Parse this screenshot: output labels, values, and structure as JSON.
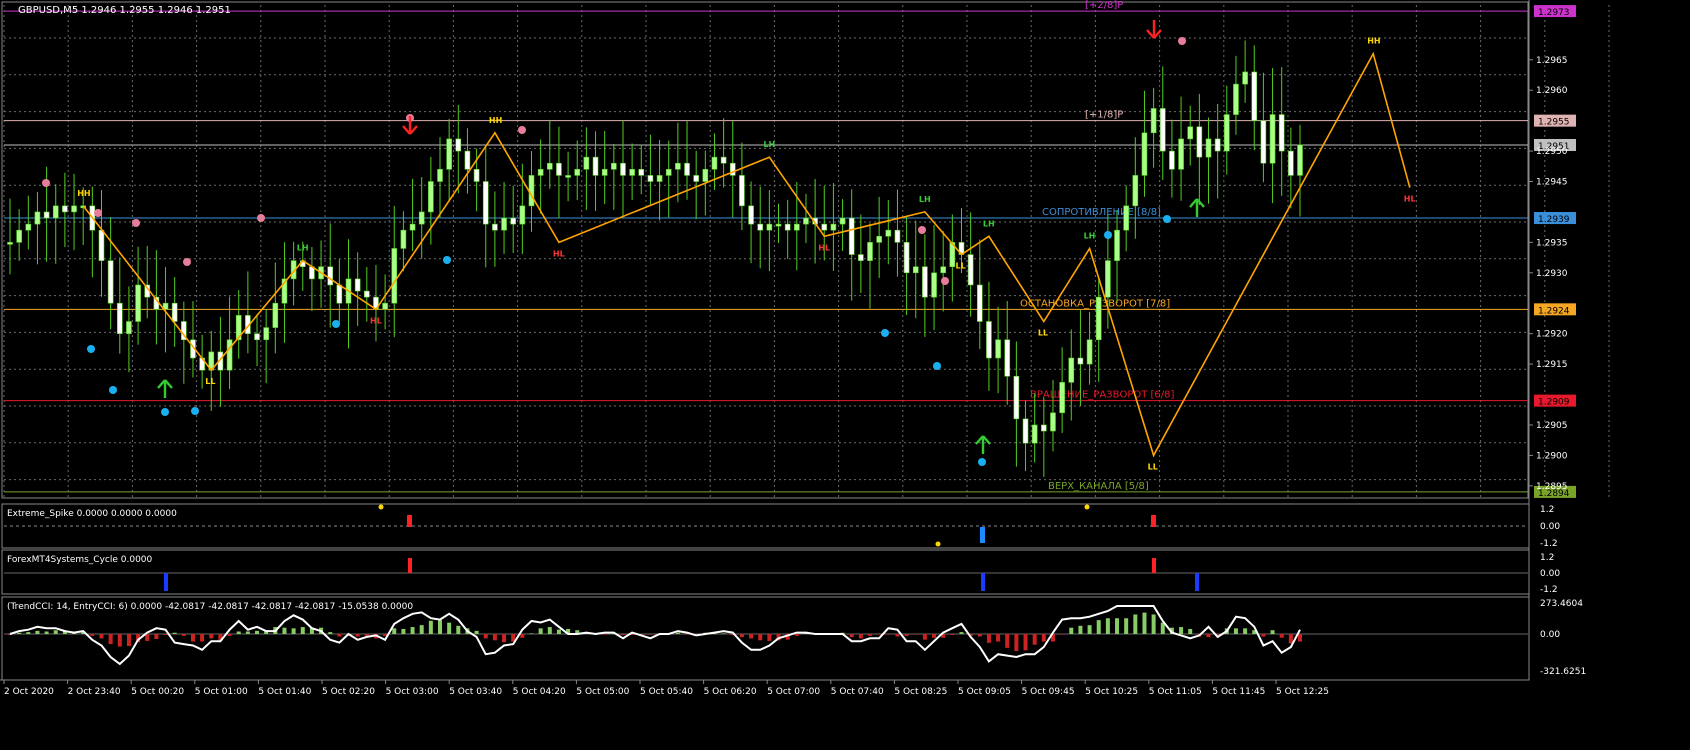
{
  "window": {
    "title": "GBPUSD,M5  1.2946 1.2955 1.2946 1.2951",
    "bg": "#000000",
    "grid": "#6b6b6b",
    "axis_text": "#ffffff"
  },
  "chart_data": {
    "type": "candlestick",
    "symbol": "GBPUSD",
    "timeframe": "M5",
    "ohlc": {
      "open": 1.2946,
      "high": 1.2955,
      "low": 1.2946,
      "close": 1.2951
    },
    "price_range": [
      1.2894,
      1.2973
    ],
    "price_ticks": [
      "1.2965",
      "1.2960",
      "1.2950",
      "1.2945",
      "1.2935",
      "1.2930",
      "1.2920",
      "1.2915",
      "1.2905",
      "1.2900",
      "1.2895"
    ],
    "time_ticks": [
      "2 Oct 2020",
      "2 Oct 23:40",
      "5 Oct 00:20",
      "5 Oct 01:00",
      "5 Oct 01:40",
      "5 Oct 02:20",
      "5 Oct 03:00",
      "5 Oct 03:40",
      "5 Oct 04:20",
      "5 Oct 05:00",
      "5 Oct 05:40",
      "5 Oct 06:20",
      "5 Oct 07:00",
      "5 Oct 07:40",
      "5 Oct 08:25",
      "5 Oct 09:05",
      "5 Oct 09:45",
      "5 Oct 10:25",
      "5 Oct 11:05",
      "5 Oct 11:45",
      "5 Oct 12:25"
    ],
    "price_levels": [
      {
        "label": "[+2/8]P",
        "price": 1.2973,
        "color": "#cc33cc",
        "badge": "1.2973"
      },
      {
        "label": "[+1/8]P",
        "price": 1.2955,
        "color": "#e0b3b3",
        "badge": "1.2955"
      },
      {
        "label": "",
        "price": 1.2951,
        "color": "#c0c0c0",
        "badge": "1.2951"
      },
      {
        "label": "СОПРОТИВЛЕНИЕ [8/8]",
        "price": 1.2939,
        "color": "#3b8fd9",
        "badge": "1.2939"
      },
      {
        "label": "ОСТАНОВКА_РАЗВОРОТ [7/8]",
        "price": 1.2924,
        "color": "#f5a623",
        "badge": "1.2924"
      },
      {
        "label": "ВРАЩЕНИЕ_РАЗВОРОТ [6/8]",
        "price": 1.2909,
        "color": "#e8192c",
        "badge": "1.2909"
      },
      {
        "label": "ВЕРХ_КАНАЛА [5/8]",
        "price": 1.2894,
        "color": "#7aa32a",
        "badge": "1.2894"
      }
    ],
    "closes": [
      1.2935,
      1.2937,
      1.2938,
      1.294,
      1.2939,
      1.2941,
      1.294,
      1.2941,
      1.2941,
      1.2937,
      1.2932,
      1.2925,
      1.292,
      1.2922,
      1.2928,
      1.2926,
      1.2924,
      1.2925,
      1.2922,
      1.2919,
      1.2916,
      1.2914,
      1.2917,
      1.2914,
      1.2919,
      1.2923,
      1.292,
      1.2919,
      1.2921,
      1.2925,
      1.2929,
      1.2932,
      1.2931,
      1.2929,
      1.2931,
      1.2928,
      1.2925,
      1.2929,
      1.2927,
      1.2926,
      1.2924,
      1.2925,
      1.2934,
      1.2937,
      1.2938,
      1.294,
      1.2945,
      1.2947,
      1.2952,
      1.295,
      1.2947,
      1.2945,
      1.2938,
      1.2937,
      1.2939,
      1.2938,
      1.2941,
      1.2946,
      1.2947,
      1.2948,
      1.2946,
      1.2946,
      1.2947,
      1.2949,
      1.2946,
      1.2947,
      1.2948,
      1.2946,
      1.2947,
      1.2946,
      1.2945,
      1.2946,
      1.2947,
      1.2948,
      1.2946,
      1.2945,
      1.2947,
      1.2949,
      1.2948,
      1.2946,
      1.2941,
      1.2938,
      1.2937,
      1.2938,
      1.2938,
      1.2937,
      1.2938,
      1.2939,
      1.2938,
      1.2937,
      1.2938,
      1.2939,
      1.2933,
      1.2932,
      1.2935,
      1.2936,
      1.2937,
      1.2935,
      1.293,
      1.2931,
      1.2926,
      1.293,
      1.2931,
      1.2935,
      1.2933,
      1.2928,
      1.2922,
      1.2916,
      1.2919,
      1.2913,
      1.2906,
      1.2902,
      1.2905,
      1.2904,
      1.2907,
      1.2912,
      1.2916,
      1.2915,
      1.2919,
      1.2926,
      1.2932,
      1.2937,
      1.2941,
      1.2946,
      1.2953,
      1.2957,
      1.295,
      1.2947,
      1.2952,
      1.2954,
      1.2949,
      1.2952,
      1.295,
      1.2956,
      1.2961,
      1.2963,
      1.2955,
      1.2948,
      1.2956,
      1.295,
      1.2946,
      1.2951
    ],
    "zigzag": [
      {
        "label": "HH",
        "time_index": 8,
        "price": 1.2941,
        "color": "#ffd700"
      },
      {
        "label": "LL",
        "time_index": 22,
        "price": 1.2914,
        "color": "#ffd700"
      },
      {
        "label": "LH",
        "time_index": 32,
        "price": 1.2932,
        "color": "#33cc33"
      },
      {
        "label": "HL",
        "time_index": 40,
        "price": 1.2924,
        "color": "#ff3333"
      },
      {
        "label": "HH",
        "time_index": 53,
        "price": 1.2953,
        "color": "#ffd700"
      },
      {
        "label": "HL",
        "time_index": 60,
        "price": 1.2935,
        "color": "#ff3333"
      },
      {
        "label": "LH",
        "time_index": 83,
        "price": 1.2949,
        "color": "#33cc33"
      },
      {
        "label": "HL",
        "time_index": 89,
        "price": 1.2936,
        "color": "#ff3333"
      },
      {
        "label": "LH",
        "time_index": 100,
        "price": 1.294,
        "color": "#33cc33"
      },
      {
        "label": "LL",
        "time_index": 104,
        "price": 1.2933,
        "color": "#ffd700"
      },
      {
        "label": "LH",
        "time_index": 107,
        "price": 1.2936,
        "color": "#33cc33"
      },
      {
        "label": "LL",
        "time_index": 113,
        "price": 1.2922,
        "color": "#ffd700"
      },
      {
        "label": "LH",
        "time_index": 118,
        "price": 1.2934,
        "color": "#33cc33"
      },
      {
        "label": "LL",
        "time_index": 125,
        "price": 1.29,
        "color": "#ffd700"
      },
      {
        "label": "HH",
        "time_index": 149,
        "price": 1.2966,
        "color": "#ffd700"
      },
      {
        "label": "HL",
        "time_index": 153,
        "price": 1.2944,
        "color": "#ff3333"
      }
    ],
    "indicators": [
      {
        "name": "Extreme_Spike",
        "values": [
          "0.0000",
          "0.0000",
          "0.0000"
        ],
        "ticks": [
          "1.2",
          "0.00",
          "-1.2"
        ]
      },
      {
        "name": "ForexMT4Systems_Cycle",
        "values": [
          "0.0000"
        ],
        "ticks": [
          "1.2",
          "0.00",
          "-1.2"
        ]
      },
      {
        "name": "TrendCCI",
        "params": "14, EntryCCI: 6",
        "values": [
          "0.0000",
          "-42.0817",
          "-42.0817",
          "-42.0817",
          "-42.0817",
          "-15.0538",
          "0.0000"
        ],
        "ticks": [
          "273.4604",
          "0.00",
          "-321.6251"
        ]
      }
    ]
  },
  "colors": {
    "bull": "#aaff88",
    "bear": "#ffffff",
    "wick": "#55cc22",
    "zigzag": "#ffa500",
    "dot_blue": "#1ab0f0",
    "dot_pink": "#e87d9b",
    "arrow_green": "#33cc33",
    "arrow_red": "#ff2222",
    "cci_line": "#ffffff",
    "cci_bull": "#88cc66",
    "cci_bear": "#cc2222"
  }
}
